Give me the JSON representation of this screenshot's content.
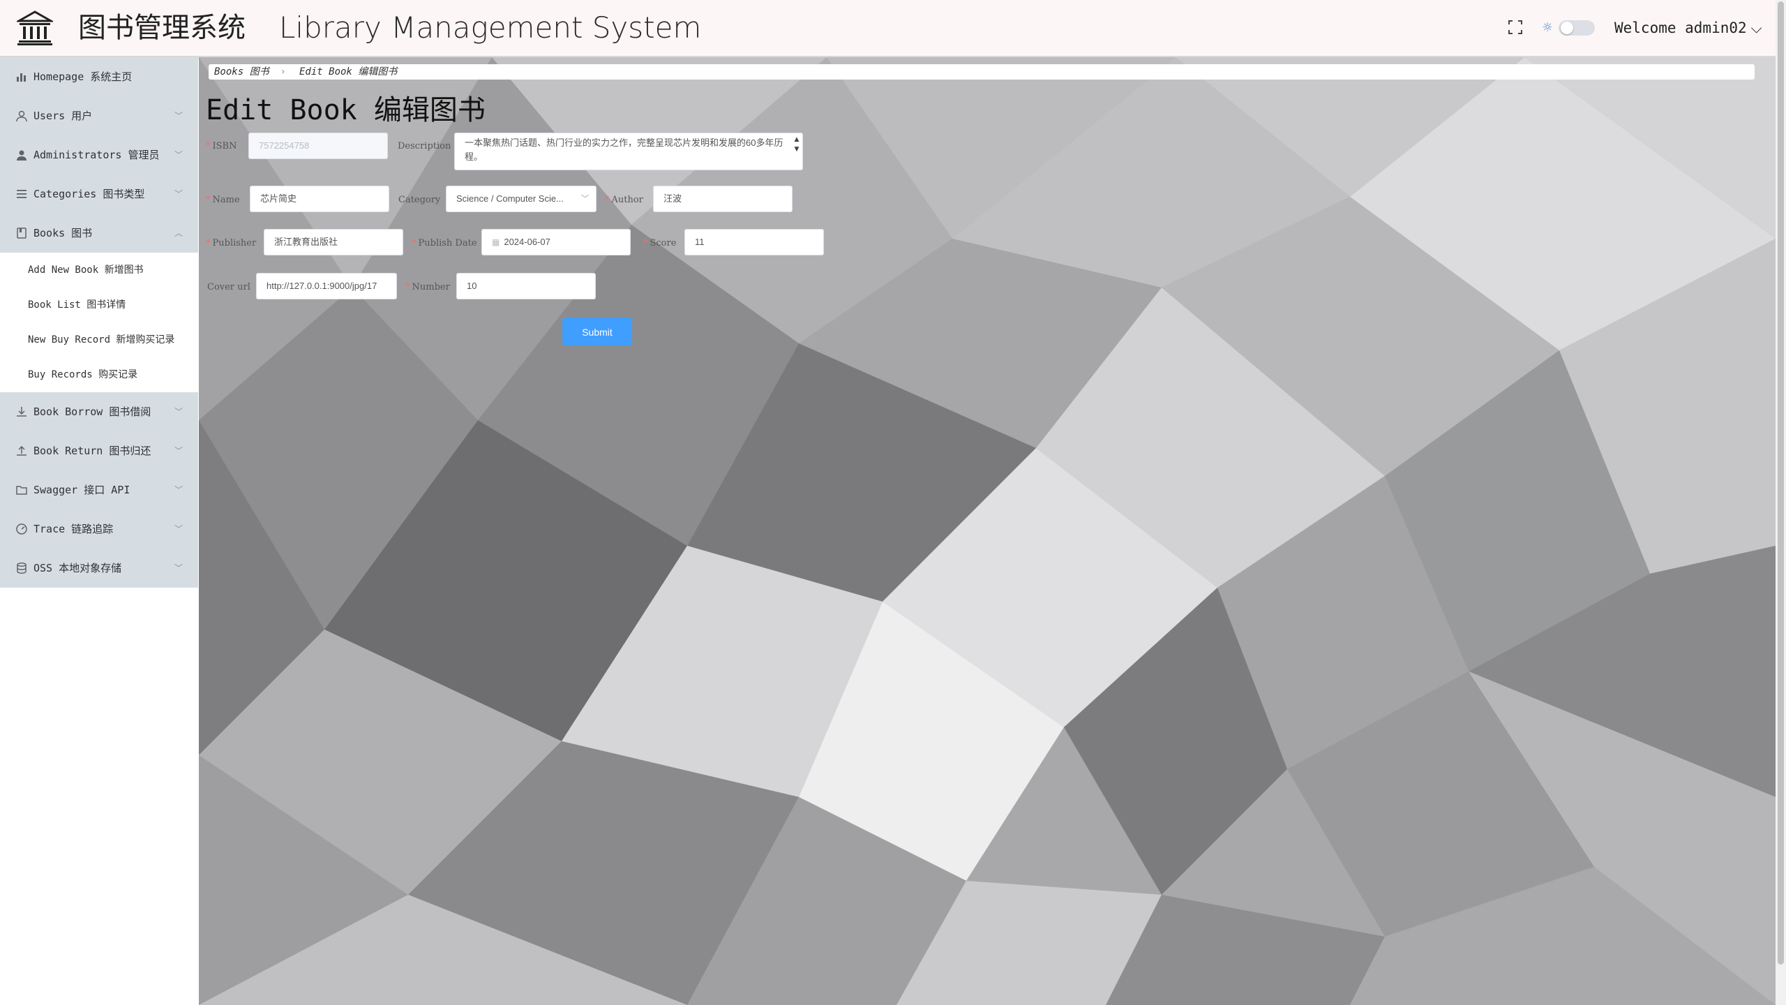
{
  "header": {
    "title_cn": "图书管理系统",
    "title_en": "Library Management System",
    "welcome": "Welcome admin02"
  },
  "sidebar": {
    "items": [
      {
        "label": "Homepage 系统主页",
        "icon": "bar-chart-icon"
      },
      {
        "label": "Users 用户",
        "icon": "user-icon"
      },
      {
        "label": "Administrators 管理员",
        "icon": "admin-user-icon"
      },
      {
        "label": "Categories 图书类型",
        "icon": "list-icon"
      },
      {
        "label": "Books 图书",
        "icon": "book-icon",
        "expanded": true
      },
      {
        "label": "Book Borrow 图书借阅",
        "icon": "download-icon"
      },
      {
        "label": "Book Return 图书归还",
        "icon": "upload-icon"
      },
      {
        "label": "Swagger 接口 API",
        "icon": "folder-icon"
      },
      {
        "label": "Trace 链路追踪",
        "icon": "gauge-icon"
      },
      {
        "label": "OSS 本地对象存储",
        "icon": "database-icon"
      }
    ],
    "books_sub": [
      "Add New Book 新增图书",
      "Book List 图书详情",
      "New Buy Record 新增购买记录",
      "Buy Records 购买记录"
    ]
  },
  "breadcrumb": {
    "level1": "Books 图书",
    "level2": "Edit Book 编辑图书"
  },
  "page_title": "Edit Book 编辑图书",
  "form": {
    "isbn": {
      "label": "ISBN",
      "value": "7572254758",
      "required": true
    },
    "description": {
      "label": "Description",
      "value": "一本聚焦热门话题、热门行业的实力之作，完整呈现芯片发明和发展的60多年历程。",
      "required": false
    },
    "name": {
      "label": "Name",
      "value": "芯片简史",
      "required": true
    },
    "category": {
      "label": "Category",
      "value": "Science / Computer Scie...",
      "required": false
    },
    "author": {
      "label": "Author",
      "value": "汪波",
      "required": true
    },
    "publisher": {
      "label": "Publisher",
      "value": "浙江教育出版社",
      "required": true
    },
    "publish_date": {
      "label": "Publish Date",
      "value": "2024-06-07",
      "required": true
    },
    "score": {
      "label": "Score",
      "value": "11",
      "required": true
    },
    "cover_url": {
      "label": "Cover url",
      "value": "http://127.0.0.1:9000/jpg/17",
      "required": false
    },
    "number": {
      "label": "Number",
      "value": "10",
      "required": true
    },
    "submit_label": "Submit"
  },
  "colors": {
    "sidebar_bg": "#d5dde3",
    "primary": "#409eff",
    "required": "#f56c6c",
    "header_bg": "#fdf6f6"
  }
}
